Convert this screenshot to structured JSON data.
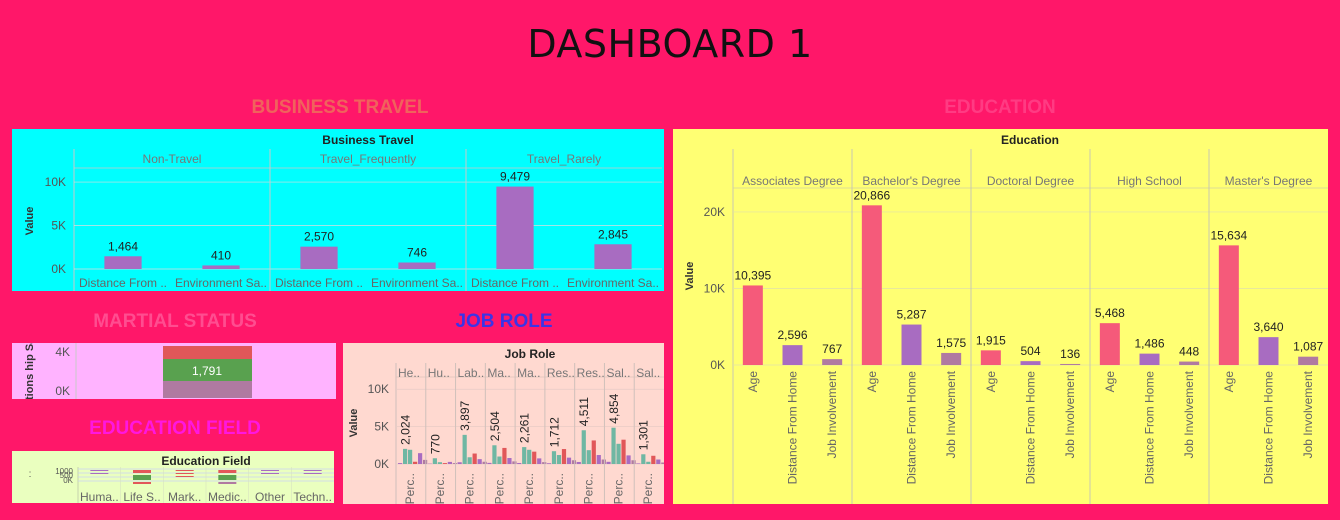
{
  "page": {
    "title": "DASHBOARD 1"
  },
  "sections": {
    "business_travel": "BUSINESS TRAVEL",
    "education": "EDUCATION",
    "martial_status": "MARTIAL STATUS",
    "job_role": "JOB ROLE",
    "education_field": "EDUCATION FIELD"
  },
  "colors": {
    "background": "#ff1769",
    "bt_panel": "#00ffff",
    "edu_panel": "#ffff73",
    "ms_panel": "#ffb3ff",
    "jr_panel": "#ffd9d0",
    "ef_panel": "#eaffbf",
    "purple": "#a86cc1",
    "pink": "#f55a7a",
    "teal": "#6fb7a3",
    "red": "#e15759",
    "green": "#59a14f",
    "mauve": "#b07aa1"
  },
  "chart_data": [
    {
      "id": "business_travel",
      "type": "bar",
      "title": "Business Travel",
      "ylabel": "Value",
      "yticks": [
        "10K",
        "5K",
        "0K"
      ],
      "ylim": [
        0,
        11500
      ],
      "facets": [
        "Non-Travel",
        "Travel_Frequently",
        "Travel_Rarely"
      ],
      "categories": [
        "Distance From ..",
        "Environment Sa.."
      ],
      "values": [
        [
          1464,
          410
        ],
        [
          2570,
          746
        ],
        [
          9479,
          2845
        ]
      ],
      "value_labels": [
        [
          "1,464",
          "410"
        ],
        [
          "2,570",
          "746"
        ],
        [
          "9,479",
          "2,845"
        ]
      ]
    },
    {
      "id": "education",
      "type": "bar",
      "title": "Education",
      "ylabel": "Value",
      "yticks": [
        "20K",
        "10K",
        "0K"
      ],
      "ylim": [
        0,
        23000
      ],
      "facets": [
        "Associates Degree",
        "Bachelor's Degree",
        "Doctoral Degree",
        "High School",
        "Master's Degree"
      ],
      "categories": [
        "Age",
        "Distance From Home",
        "Job Involvement"
      ],
      "values": [
        [
          10395,
          2596,
          767
        ],
        [
          20866,
          5287,
          1575
        ],
        [
          1915,
          504,
          136
        ],
        [
          5468,
          1486,
          448
        ],
        [
          15634,
          3640,
          1087
        ]
      ],
      "value_labels": [
        [
          "10,395",
          "2,596",
          "767"
        ],
        [
          "20,866",
          "5,287",
          "1,575"
        ],
        [
          "1,915",
          "504",
          "136"
        ],
        [
          "5,468",
          "1,486",
          "448"
        ],
        [
          "15,634",
          "3,640",
          "1,087"
        ]
      ]
    },
    {
      "id": "martial_status",
      "type": "bar",
      "ylabel": "Relations hip Satis..",
      "yticks": [
        "4K",
        "0K"
      ],
      "stack_label": "1,791"
    },
    {
      "id": "job_role",
      "type": "bar",
      "title": "Job Role",
      "ylabel": "Value",
      "yticks": [
        "10K",
        "5K",
        "0K"
      ],
      "ylim": [
        0,
        11500
      ],
      "facets": [
        "He..",
        "Hu..",
        "Lab..",
        "Ma..",
        "Ma..",
        "Res..",
        "Res..",
        "Sal..",
        "Sal.."
      ],
      "category_label": "Perc..",
      "label_values": [
        2024,
        770,
        3897,
        2504,
        2261,
        1712,
        4511,
        4854,
        1301
      ],
      "value_labels": [
        "2,024",
        "770",
        "3,897",
        "2,504",
        "2,261",
        "1,712",
        "4,511",
        "4,854",
        "1,301"
      ],
      "other_values": [
        [
          1900,
          300,
          1450,
          550
        ],
        [
          240,
          120,
          280,
          120
        ],
        [
          900,
          1400,
          650,
          300
        ],
        [
          1000,
          2150,
          800,
          350
        ],
        [
          1900,
          1650,
          750,
          250
        ],
        [
          1200,
          2000,
          850,
          500
        ],
        [
          1850,
          3150,
          1200,
          600
        ],
        [
          2700,
          3250,
          1150,
          500
        ],
        [
          300,
          1100,
          600,
          200
        ]
      ]
    },
    {
      "id": "education_field",
      "type": "bar",
      "title": "Education Field",
      "yticks": [
        "1000",
        "500",
        "0K"
      ],
      "categories": [
        "Huma..",
        "Life S..",
        "Mark..",
        "Medic..",
        "Other",
        "Techn.."
      ]
    }
  ]
}
